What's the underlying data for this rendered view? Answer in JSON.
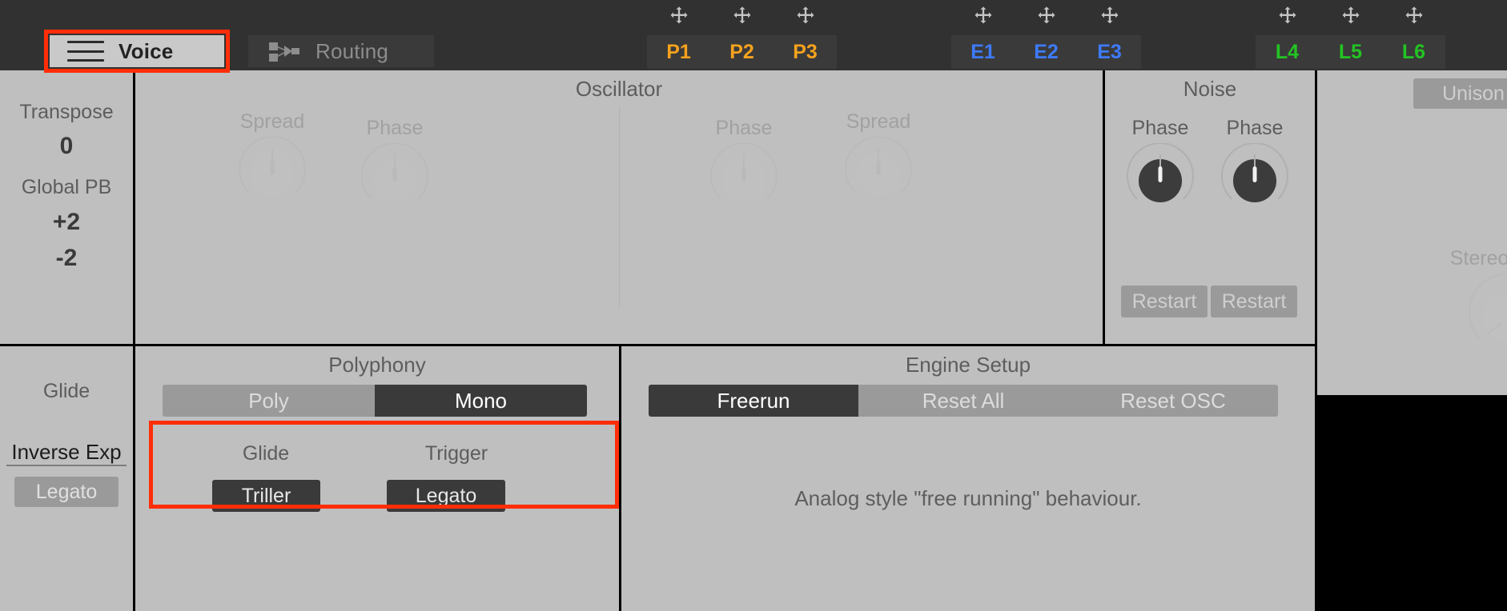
{
  "topbar": {
    "tabs": [
      {
        "label": "Voice",
        "icon": "hamburger-menu-icon",
        "active": true
      },
      {
        "label": "Routing",
        "icon": "routing-nodes-icon",
        "active": false
      }
    ],
    "mod_groups": [
      {
        "name": "perform",
        "color": "#f5a21e",
        "slots": [
          "P1",
          "P2",
          "P3"
        ]
      },
      {
        "name": "envelope",
        "color": "#3d7bff",
        "slots": [
          "E1",
          "E2",
          "E3"
        ]
      },
      {
        "name": "lfo",
        "color": "#23c423",
        "slots": [
          "L4",
          "L5",
          "L6"
        ]
      }
    ],
    "drag_handle_icon": "move-arrows-icon"
  },
  "voice": {
    "transpose_label": "Transpose",
    "transpose_value": "0",
    "global_pb_label": "Global PB",
    "pb_up": "+2",
    "pb_down": "-2",
    "glide_label": "Glide",
    "glide_curve": "Inverse Exp",
    "legato_button": "Legato"
  },
  "oscillator": {
    "title": "Oscillator",
    "knobs": [
      {
        "label": "Spread",
        "value": 50,
        "disabled": true
      },
      {
        "label": "Phase",
        "value": 50,
        "disabled": true
      },
      {
        "label": "Phase",
        "value": 50,
        "disabled": true
      },
      {
        "label": "Spread",
        "value": 50,
        "disabled": true
      }
    ]
  },
  "noise": {
    "title": "Noise",
    "knobs": [
      {
        "label": "Phase",
        "value": 50,
        "disabled": false
      },
      {
        "label": "Phase",
        "value": 50,
        "disabled": false
      }
    ],
    "buttons": [
      "Restart",
      "Restart"
    ]
  },
  "unison": {
    "button": "Unison",
    "knob_label": "Stereo Width",
    "knob_value": 40
  },
  "polyphony": {
    "title": "Polyphony",
    "options": [
      "Poly",
      "Mono"
    ],
    "selected": "Mono",
    "glide_label": "Glide",
    "glide_mode": "Triller",
    "trigger_label": "Trigger",
    "trigger_mode": "Legato"
  },
  "engine": {
    "title": "Engine Setup",
    "options": [
      "Freerun",
      "Reset All",
      "Reset OSC"
    ],
    "selected": "Freerun",
    "description": "Analog style \"free running\" behaviour."
  },
  "colors": {
    "highlight": "#ff2d08",
    "panel": "#bfbfbf",
    "chrome": "#313131",
    "accent_perform": "#f5a21e",
    "accent_envelope": "#3d7bff",
    "accent_lfo": "#23c423"
  }
}
